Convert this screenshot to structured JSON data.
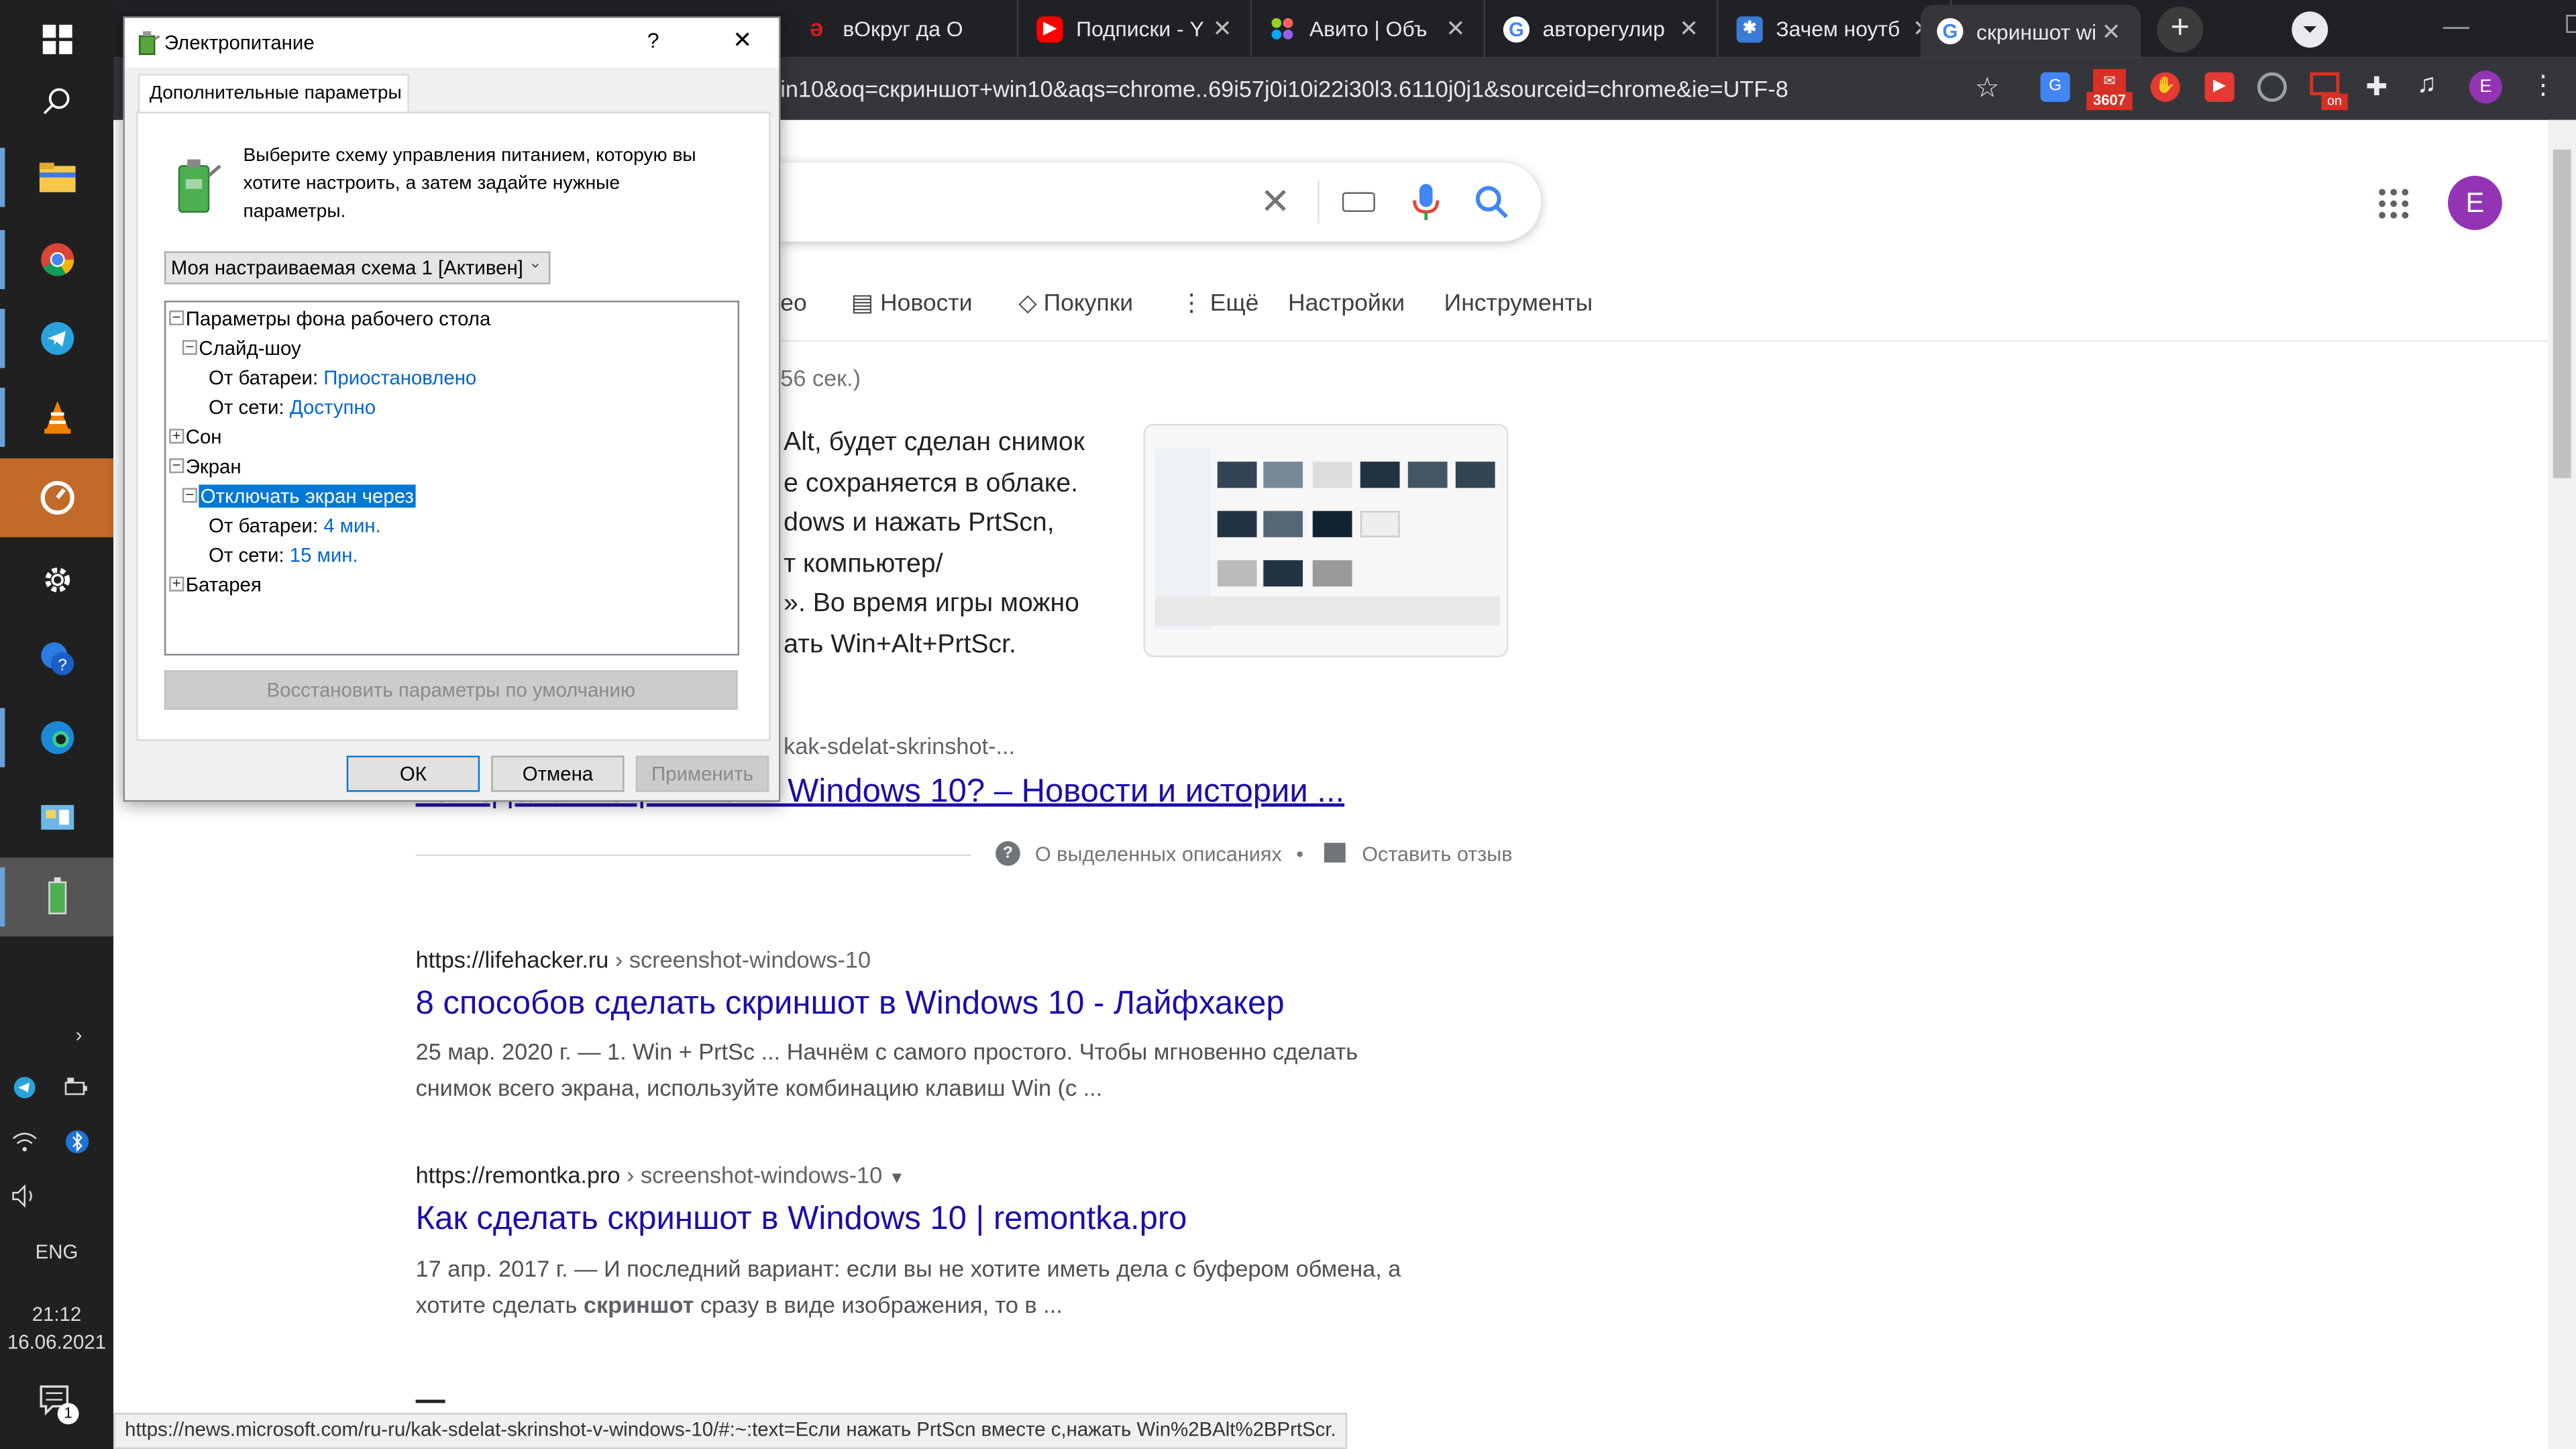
{
  "taskbar": {
    "language": "ENG",
    "time": "21:12",
    "date": "16.06.2021",
    "notifications": "1"
  },
  "browser": {
    "tabs": [
      {
        "label": "вОкруг да О",
        "icon": "vokrug-icon",
        "color": "#cc1f1f"
      },
      {
        "label": "Подписки - Y",
        "icon": "youtube-icon",
        "color": "#ff0000"
      },
      {
        "label": "Авито | Объ",
        "icon": "avito-icon",
        "color": "#4a90e2"
      },
      {
        "label": "авторегулир",
        "icon": "google-icon",
        "color": "#4285f4"
      },
      {
        "label": "Зачем ноутб",
        "icon": "site-icon",
        "color": "#3a7bd5"
      },
      {
        "label": "скриншот wi",
        "icon": "google-icon",
        "color": "#4285f4"
      }
    ],
    "url": "in10&oq=скриншот+win10&aqs=chrome..69i57j0i10i22i30l3.6110j0j1&sourceid=chrome&ie=UTF-8",
    "ext_badge": "3607",
    "ext_on": "on",
    "avatar": "E",
    "status_url": "https://news.microsoft.com/ru-ru/kak-sdelat-skrinshot-v-windows-10/#:~:text=Если нажать PrtScn вместе с,нажать Win%2BAlt%2BPrtScr."
  },
  "google": {
    "nav": [
      "ео",
      "Новости",
      "Покупки",
      "Ещё",
      "Настройки",
      "Инструменты"
    ],
    "stats": "56 сек.)",
    "featured_lines": [
      "Alt, будет сделан снимок",
      "е сохраняется в облаке.",
      "dows и нажать PrtScn,",
      "т компьютер/",
      "». Во время игры можно",
      "ать Win+Alt+PrtScr."
    ],
    "featured_source": "kak-sdelat-skrinshot-...",
    "featured_title": "Как сделать скриншот в Windows 10? – Новости и истории ...",
    "about_snippets": "О выделенных описаниях",
    "feedback": "Оставить отзыв",
    "results": [
      {
        "domain": "https://lifehacker.ru",
        "path": " › screenshot-windows-10",
        "title": "8 способов сделать скриншот в Windows 10 - Лайфхакер",
        "line1": "25 мар. 2020 г. — 1. Win + PrtSc ... Начнём с самого простого. Чтобы мгновенно сделать",
        "line2": "снимок всего экрана, используйте комбинацию клавиш Win (с ..."
      },
      {
        "domain": "https://remontka.pro",
        "path": " › screenshot-windows-10",
        "title": "Как сделать скриншот в Windows 10 | remontka.pro",
        "line1": "17 апр. 2017 г. — И последний вариант: если вы не хотите иметь дела с буфером обмена, а",
        "line2a": "хотите сделать ",
        "line2b": "скриншот",
        "line2c": " сразу в виде изображения, то в ..."
      }
    ]
  },
  "dialog": {
    "title": "Электропитание",
    "help": "?",
    "close": "✕",
    "tab": "Дополнительные параметры",
    "intro": [
      "Выберите схему управления питанием, которую вы",
      "хотите настроить, а затем задайте нужные",
      "параметры."
    ],
    "scheme": "Моя настраиваемая схема 1 [Активен]",
    "tree": {
      "desktop_bg": "Параметры фона рабочего стола",
      "slideshow": "Слайд-шоу",
      "on_battery_label": "От батареи: ",
      "on_battery_value": "Приостановлено",
      "on_ac_label": "От сети: ",
      "on_ac_value": "Доступно",
      "sleep": "Сон",
      "display": "Экран",
      "turn_off": "Отключать экран через",
      "off_battery_label": "От батареи: ",
      "off_battery_value": "4 мин.",
      "off_ac_label": "От сети: ",
      "off_ac_value": "15 мин.",
      "battery": "Батарея"
    },
    "restore": "Восстановить параметры по умолчанию",
    "ok": "ОК",
    "cancel": "Отмена",
    "apply": "Применить"
  }
}
